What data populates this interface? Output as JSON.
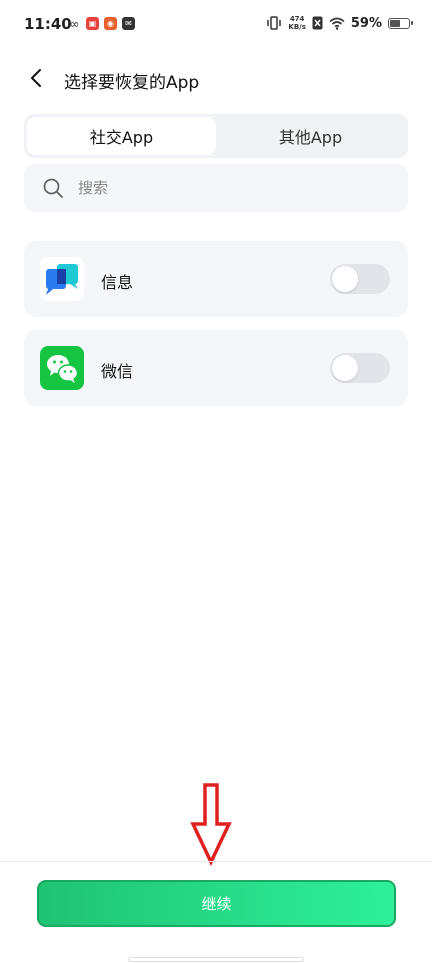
{
  "status_bar": {
    "time": "11:40",
    "net_speed_value": "474",
    "net_speed_unit": "KB/s",
    "battery_percent_text": "59%",
    "battery_level": 0.59
  },
  "header": {
    "title": "选择要恢复的App"
  },
  "tabs": [
    {
      "label": "社交App",
      "active": true
    },
    {
      "label": "其他App",
      "active": false
    }
  ],
  "search": {
    "placeholder": "搜索"
  },
  "apps": [
    {
      "name": "信息",
      "enabled": false
    },
    {
      "name": "微信",
      "enabled": false
    }
  ],
  "footer": {
    "continue_label": "继续"
  },
  "colors": {
    "accent_green": "#22d07f",
    "annotation_red": "#e0201f"
  }
}
